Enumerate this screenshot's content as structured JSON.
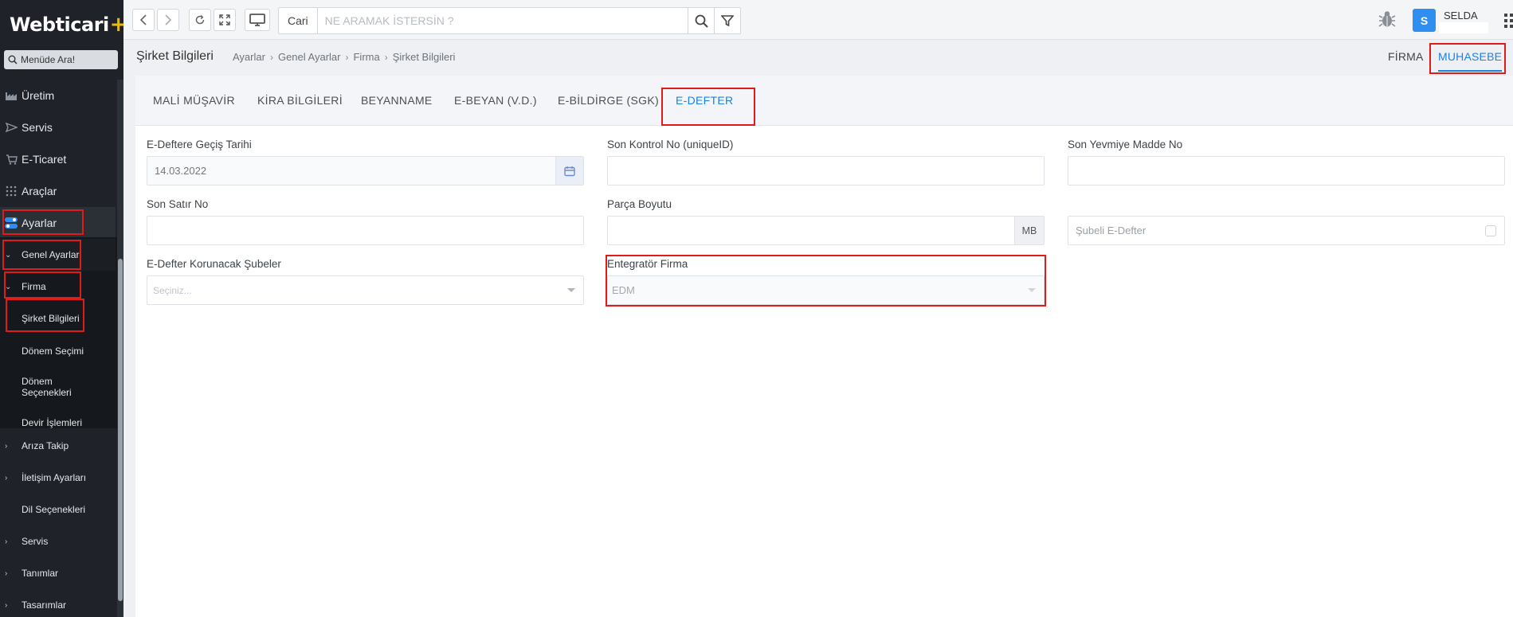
{
  "app": {
    "logo_text": "Webticari",
    "logo_plus": "+"
  },
  "sidebar": {
    "search_label": "Menüde Ara!",
    "items": [
      {
        "label": "Üretim",
        "icon": "factory-icon"
      },
      {
        "label": "Servis",
        "icon": "send-icon"
      },
      {
        "label": "E-Ticaret",
        "icon": "cart-icon"
      },
      {
        "label": "Araçlar",
        "icon": "grid-icon"
      },
      {
        "label": "Ayarlar",
        "icon": "settings-toggle-icon"
      }
    ],
    "tree": [
      {
        "label": "Genel Ayarlar"
      },
      {
        "label": "Firma"
      },
      {
        "label": "Şirket Bilgileri"
      },
      {
        "label": "Dönem Seçimi"
      },
      {
        "label": "Dönem Seçenekleri"
      },
      {
        "label": "Devir İşlemleri"
      },
      {
        "label": "Arıza Takip"
      },
      {
        "label": "İletişim Ayarları"
      },
      {
        "label": "Dil Seçenekleri"
      },
      {
        "label": "Servis"
      },
      {
        "label": "Tanımlar"
      },
      {
        "label": "Tasarımlar"
      }
    ]
  },
  "topbar": {
    "search_category": "Cari",
    "search_placeholder": "NE ARAMAK İSTERSİN ?",
    "user_initial": "S",
    "user_name": "SELDA"
  },
  "breadcrumb": {
    "title": "Şirket Bilgileri",
    "path": [
      "Ayarlar",
      "Genel Ayarlar",
      "Firma",
      "Şirket Bilgileri"
    ]
  },
  "right_tabs": {
    "firma": "FİRMA",
    "muhasebe": "MUHASEBE"
  },
  "tabs": [
    "MALİ MÜŞAVİR",
    "KİRA BİLGİLERİ",
    "BEYANNAME",
    "E-BEYAN (V.D.)",
    "E-BİLDİRGE (SGK)",
    "E-DEFTER"
  ],
  "form": {
    "gecis_tarihi_label": "E-Deftere Geçiş Tarihi",
    "gecis_tarihi_value": "14.03.2022",
    "son_kontrol_label": "Son Kontrol No (uniqueID)",
    "son_kontrol_value": "",
    "son_yevmiye_label": "Son Yevmiye Madde No",
    "son_yevmiye_value": "",
    "son_satir_label": "Son Satır No",
    "son_satir_value": "",
    "parca_boyutu_label": "Parça Boyutu",
    "parca_boyutu_value": "",
    "parca_boyutu_unit": "MB",
    "subeli_label": "Şubeli E-Defter",
    "korunacak_label": "E-Defter Korunacak Şubeler",
    "korunacak_placeholder": "Seçiniz...",
    "entegrator_label": "Entegratör Firma",
    "entegrator_value": "EDM"
  },
  "colors": {
    "accent": "#1b82e4",
    "highlight": "#e01b1b",
    "sidebar_bg": "#1f2329"
  }
}
